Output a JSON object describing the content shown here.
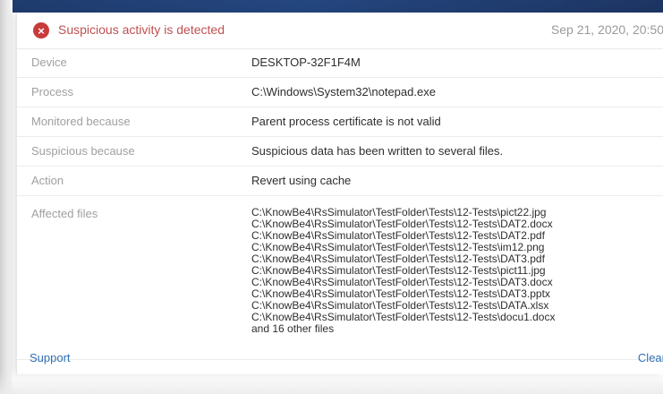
{
  "alert": {
    "title": "Suspicious activity is detected",
    "date": "Sep 21, 2020, 20:50",
    "icon": "error-x-icon",
    "accent_color": "#c93a3a"
  },
  "details": [
    {
      "label": "Device",
      "value": "DESKTOP-32F1F4M"
    },
    {
      "label": "Process",
      "value": "C:\\Windows\\System32\\notepad.exe"
    },
    {
      "label": "Monitored because",
      "value": "Parent process certificate is not valid"
    },
    {
      "label": "Suspicious because",
      "value": "Suspicious data has been written to several files."
    },
    {
      "label": "Action",
      "value": "Revert using cache"
    }
  ],
  "affected_files": {
    "label": "Affected files",
    "files": [
      "C:\\KnowBe4\\RsSimulator\\TestFolder\\Tests\\12-Tests\\pict22.jpg",
      "C:\\KnowBe4\\RsSimulator\\TestFolder\\Tests\\12-Tests\\DAT2.docx",
      "C:\\KnowBe4\\RsSimulator\\TestFolder\\Tests\\12-Tests\\DAT2.pdf",
      "C:\\KnowBe4\\RsSimulator\\TestFolder\\Tests\\12-Tests\\im12.png",
      "C:\\KnowBe4\\RsSimulator\\TestFolder\\Tests\\12-Tests\\DAT3.pdf",
      "C:\\KnowBe4\\RsSimulator\\TestFolder\\Tests\\12-Tests\\pict11.jpg",
      "C:\\KnowBe4\\RsSimulator\\TestFolder\\Tests\\12-Tests\\DAT3.docx",
      "C:\\KnowBe4\\RsSimulator\\TestFolder\\Tests\\12-Tests\\DAT3.pptx",
      "C:\\KnowBe4\\RsSimulator\\TestFolder\\Tests\\12-Tests\\DATA.xlsx",
      "C:\\KnowBe4\\RsSimulator\\TestFolder\\Tests\\12-Tests\\docu1.docx"
    ],
    "more_text": "and 16 other files"
  },
  "footer": {
    "support_label": "Support",
    "clear_label": "Clear"
  }
}
